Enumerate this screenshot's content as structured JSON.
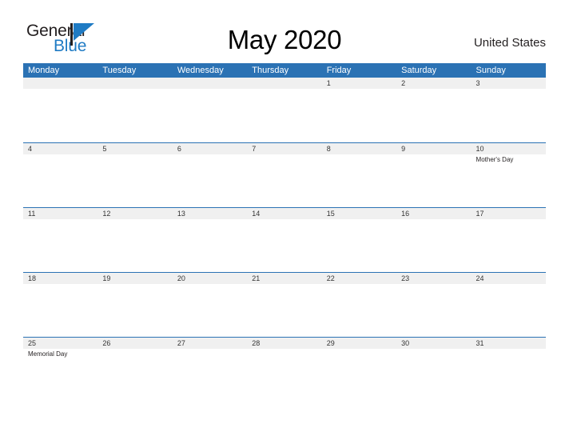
{
  "brand": {
    "name_part1": "General",
    "name_part2": "Blue",
    "flag_color": "#1f7bc4",
    "text_color": "#231f20"
  },
  "header": {
    "title": "May 2020",
    "country": "United States"
  },
  "theme": {
    "header_blue": "#2b72b4",
    "band_gray": "#f0f0f0",
    "rule_blue": "#2b72b4",
    "background": "#ffffff"
  },
  "calendar": {
    "weekdays": [
      "Monday",
      "Tuesday",
      "Wednesday",
      "Thursday",
      "Friday",
      "Saturday",
      "Sunday"
    ],
    "weeks": [
      {
        "days": [
          {
            "num": "",
            "event": ""
          },
          {
            "num": "",
            "event": ""
          },
          {
            "num": "",
            "event": ""
          },
          {
            "num": "",
            "event": ""
          },
          {
            "num": "1",
            "event": ""
          },
          {
            "num": "2",
            "event": ""
          },
          {
            "num": "3",
            "event": ""
          }
        ]
      },
      {
        "days": [
          {
            "num": "4",
            "event": ""
          },
          {
            "num": "5",
            "event": ""
          },
          {
            "num": "6",
            "event": ""
          },
          {
            "num": "7",
            "event": ""
          },
          {
            "num": "8",
            "event": ""
          },
          {
            "num": "9",
            "event": ""
          },
          {
            "num": "10",
            "event": "Mother's Day"
          }
        ]
      },
      {
        "days": [
          {
            "num": "11",
            "event": ""
          },
          {
            "num": "12",
            "event": ""
          },
          {
            "num": "13",
            "event": ""
          },
          {
            "num": "14",
            "event": ""
          },
          {
            "num": "15",
            "event": ""
          },
          {
            "num": "16",
            "event": ""
          },
          {
            "num": "17",
            "event": ""
          }
        ]
      },
      {
        "days": [
          {
            "num": "18",
            "event": ""
          },
          {
            "num": "19",
            "event": ""
          },
          {
            "num": "20",
            "event": ""
          },
          {
            "num": "21",
            "event": ""
          },
          {
            "num": "22",
            "event": ""
          },
          {
            "num": "23",
            "event": ""
          },
          {
            "num": "24",
            "event": ""
          }
        ]
      },
      {
        "days": [
          {
            "num": "25",
            "event": "Memorial Day"
          },
          {
            "num": "26",
            "event": ""
          },
          {
            "num": "27",
            "event": ""
          },
          {
            "num": "28",
            "event": ""
          },
          {
            "num": "29",
            "event": ""
          },
          {
            "num": "30",
            "event": ""
          },
          {
            "num": "31",
            "event": ""
          }
        ]
      }
    ]
  }
}
